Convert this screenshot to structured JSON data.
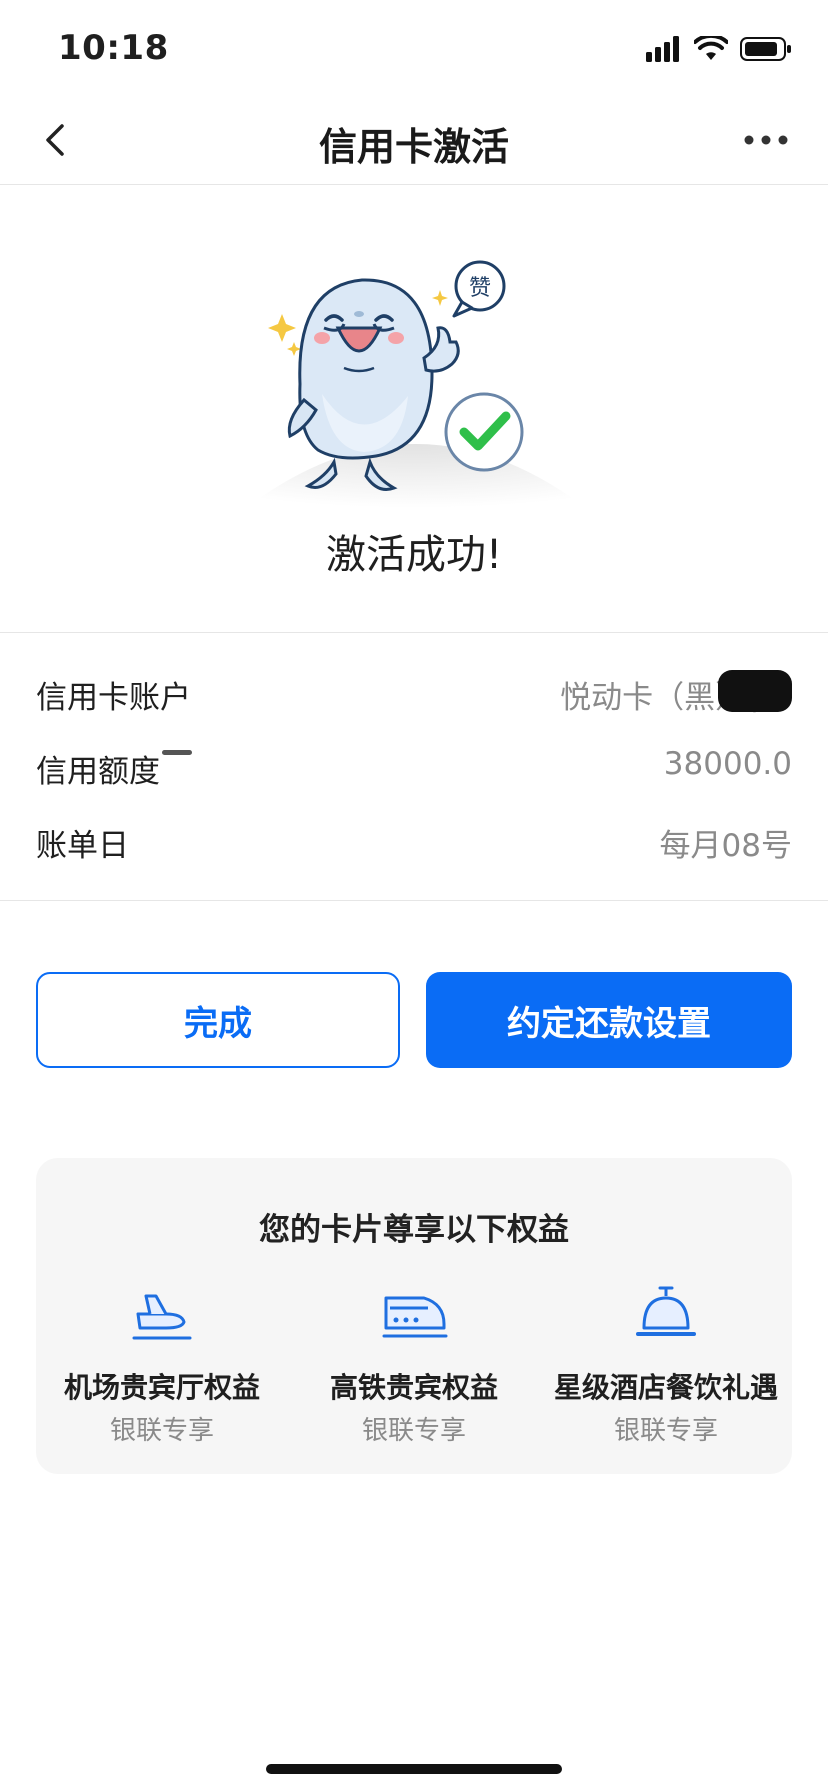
{
  "status_bar": {
    "time": "10:18"
  },
  "nav": {
    "title": "信用卡激活",
    "back_icon": "chevron-left-icon",
    "more_icon": "more-dots-icon"
  },
  "hero": {
    "mascot_bubble": "赞",
    "title": "激活成功!"
  },
  "info": {
    "rows": [
      {
        "label": "信用卡账户",
        "value": "悦动卡（黑）(6"
      },
      {
        "label": "信用额度",
        "value": "38000.0"
      },
      {
        "label": "账单日",
        "value": "每月08号"
      }
    ]
  },
  "buttons": {
    "done": "完成",
    "autopay": "约定还款设置"
  },
  "benefits": {
    "title": "您的卡片尊享以下权益",
    "items": [
      {
        "name": "机场贵宾厅权益",
        "sub": "银联专享",
        "icon": "airplane-icon"
      },
      {
        "name": "高铁贵宾权益",
        "sub": "银联专享",
        "icon": "train-icon"
      },
      {
        "name": "星级酒店餐饮礼遇",
        "sub": "银联专享",
        "icon": "service-bell-icon"
      }
    ]
  },
  "colors": {
    "accent": "#0a6cf5",
    "success": "#2fbf4a",
    "muted": "#8a8a8a",
    "card_bg": "#f6f6f6"
  }
}
